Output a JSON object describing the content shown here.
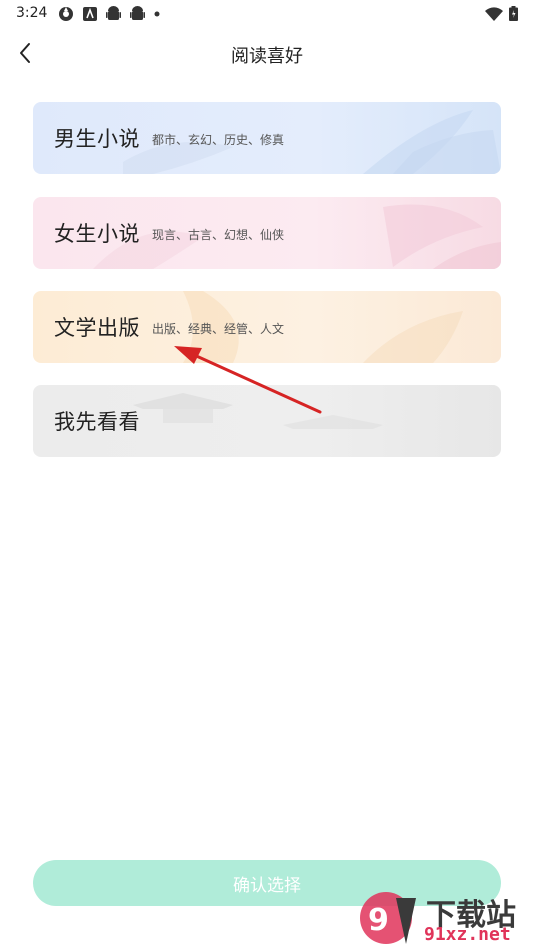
{
  "status_bar": {
    "time": "3:24"
  },
  "header": {
    "title": "阅读喜好"
  },
  "cards": [
    {
      "title": "男生小说",
      "subtitle": "都市、玄幻、历史、修真"
    },
    {
      "title": "女生小说",
      "subtitle": "现言、古言、幻想、仙侠"
    },
    {
      "title": "文学出版",
      "subtitle": "出版、经典、经管、人文"
    },
    {
      "title": "我先看看",
      "subtitle": ""
    }
  ],
  "confirm_button": {
    "label": "确认选择"
  },
  "watermark": {
    "top": "下载站",
    "bottom": "91xz.net"
  },
  "colors": {
    "male_card": "#dfe9fb",
    "female_card": "#fbe6ee",
    "literature_card": "#fdecd5",
    "skip_card": "#ececec",
    "confirm_button": "#b0ecd9",
    "annotation_arrow": "#d62424"
  }
}
